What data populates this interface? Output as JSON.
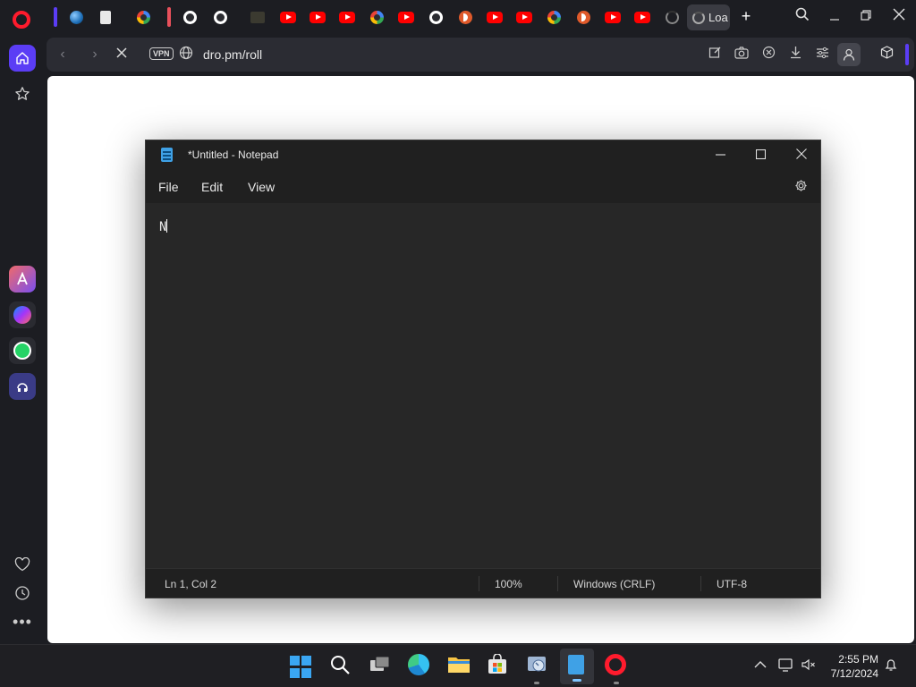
{
  "browser": {
    "active_tab_label": "Loa",
    "url": "dro.pm/roll",
    "vpn_label": "VPN",
    "tabs": [
      {
        "icon": "earth-icon"
      },
      {
        "icon": "document-icon"
      },
      {
        "icon": "google-icon"
      },
      {
        "icon": "github-icon"
      },
      {
        "icon": "github-icon"
      },
      {
        "icon": "thumbnail-icon"
      },
      {
        "icon": "youtube-icon"
      },
      {
        "icon": "youtube-icon"
      },
      {
        "icon": "youtube-icon"
      },
      {
        "icon": "google-icon"
      },
      {
        "icon": "youtube-icon"
      },
      {
        "icon": "github-icon"
      },
      {
        "icon": "dropout-icon"
      },
      {
        "icon": "youtube-icon"
      },
      {
        "icon": "youtube-icon"
      },
      {
        "icon": "google-icon"
      },
      {
        "icon": "dropout-icon"
      },
      {
        "icon": "youtube-icon"
      },
      {
        "icon": "youtube-icon"
      },
      {
        "icon": "loading-icon"
      }
    ],
    "accent_color": "#5b3df5"
  },
  "notepad": {
    "title": "*Untitled - Notepad",
    "menu": {
      "file": "File",
      "edit": "Edit",
      "view": "View"
    },
    "content": "N",
    "status": {
      "position": "Ln 1, Col 2",
      "zoom": "100%",
      "line_ending": "Windows (CRLF)",
      "encoding": "UTF-8"
    }
  },
  "taskbar": {
    "time": "2:55 PM",
    "date": "7/12/2024"
  }
}
